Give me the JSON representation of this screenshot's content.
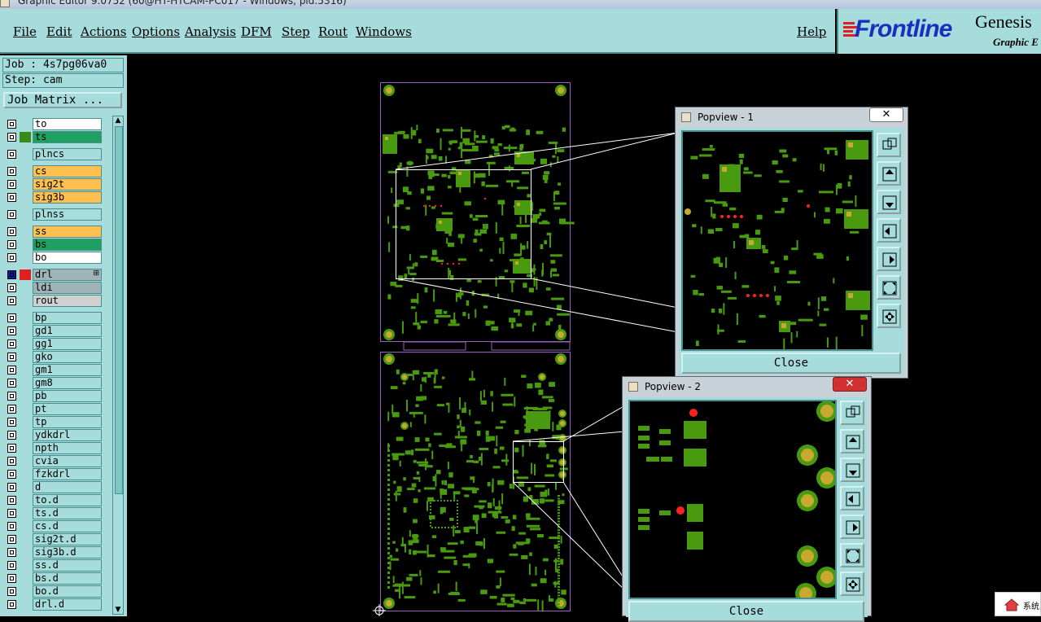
{
  "window": {
    "title": "Graphic Editor 9.0752 (60@HT-HTCAM-PC017 - Windows, pid:5316)"
  },
  "menu": {
    "file": "File",
    "edit": "Edit",
    "actions": "Actions",
    "options": "Options",
    "analysis": "Analysis",
    "dfm": "DFM",
    "step": "Step",
    "rout": "Rout",
    "windows": "Windows",
    "help": "Help"
  },
  "logo": {
    "brand": "Frontline",
    "product": "Genesis",
    "subtitle": "Graphic E"
  },
  "job": {
    "job_line": "Job : 4s7pg06va0",
    "step_line": "Step: cam",
    "matrix_button": "Job Matrix ..."
  },
  "layers": [
    {
      "name": "to",
      "fill": "#ffffff",
      "swatch": ""
    },
    {
      "name": "ts",
      "fill": "#20a060",
      "swatch": "#3a8a1a"
    },
    {
      "name": "plncs",
      "fill": "#a6dcdc",
      "swatch": ""
    },
    {
      "name": "cs",
      "fill": "#ffc050",
      "swatch": ""
    },
    {
      "name": "sig2t",
      "fill": "#ffc050",
      "swatch": ""
    },
    {
      "name": "sig3b",
      "fill": "#ffc050",
      "swatch": ""
    },
    {
      "name": "plnss",
      "fill": "#a6dcdc",
      "swatch": ""
    },
    {
      "name": "ss",
      "fill": "#ffc050",
      "swatch": ""
    },
    {
      "name": "bs",
      "fill": "#20a060",
      "swatch": ""
    },
    {
      "name": "bo",
      "fill": "#ffffff",
      "swatch": ""
    },
    {
      "name": "drl",
      "fill": "#a0b4b8",
      "swatch": "#e02020",
      "mark": "⊞",
      "active": true
    },
    {
      "name": "ldi",
      "fill": "#a0b4b8",
      "swatch": ""
    },
    {
      "name": "rout",
      "fill": "#d0d0d0",
      "swatch": ""
    },
    {
      "name": "bp",
      "fill": "#a6dcdc",
      "swatch": ""
    },
    {
      "name": "gd1",
      "fill": "#a6dcdc",
      "swatch": ""
    },
    {
      "name": "gg1",
      "fill": "#a6dcdc",
      "swatch": ""
    },
    {
      "name": "gko",
      "fill": "#a6dcdc",
      "swatch": ""
    },
    {
      "name": "gm1",
      "fill": "#a6dcdc",
      "swatch": ""
    },
    {
      "name": "gm8",
      "fill": "#a6dcdc",
      "swatch": ""
    },
    {
      "name": "pb",
      "fill": "#a6dcdc",
      "swatch": ""
    },
    {
      "name": "pt",
      "fill": "#a6dcdc",
      "swatch": ""
    },
    {
      "name": "tp",
      "fill": "#a6dcdc",
      "swatch": ""
    },
    {
      "name": "ydkdrl",
      "fill": "#a6dcdc",
      "swatch": ""
    },
    {
      "name": "npth",
      "fill": "#a6dcdc",
      "swatch": ""
    },
    {
      "name": "cvia",
      "fill": "#a6dcdc",
      "swatch": ""
    },
    {
      "name": "fzkdrl",
      "fill": "#a6dcdc",
      "swatch": ""
    },
    {
      "name": "d",
      "fill": "#a6dcdc",
      "swatch": ""
    },
    {
      "name": "to.d",
      "fill": "#a6dcdc",
      "swatch": ""
    },
    {
      "name": "ts.d",
      "fill": "#a6dcdc",
      "swatch": ""
    },
    {
      "name": "cs.d",
      "fill": "#a6dcdc",
      "swatch": ""
    },
    {
      "name": "sig2t.d",
      "fill": "#a6dcdc",
      "swatch": ""
    },
    {
      "name": "sig3b.d",
      "fill": "#a6dcdc",
      "swatch": ""
    },
    {
      "name": "ss.d",
      "fill": "#a6dcdc",
      "swatch": ""
    },
    {
      "name": "bs.d",
      "fill": "#a6dcdc",
      "swatch": ""
    },
    {
      "name": "bo.d",
      "fill": "#a6dcdc",
      "swatch": ""
    },
    {
      "name": "drl.d",
      "fill": "#a6dcdc",
      "swatch": ""
    }
  ],
  "popview1": {
    "title": "Popview - 1",
    "close_label": "Close"
  },
  "popview2": {
    "title": "Popview - 2",
    "close_label": "Close"
  },
  "system_badge": {
    "text": "系统"
  },
  "colors": {
    "panel": "#a6dcdc",
    "copper": "#4a9a10",
    "pad_ring": "#c8a830",
    "drill_dot": "#ff2020",
    "outline": "#9a60c8"
  }
}
